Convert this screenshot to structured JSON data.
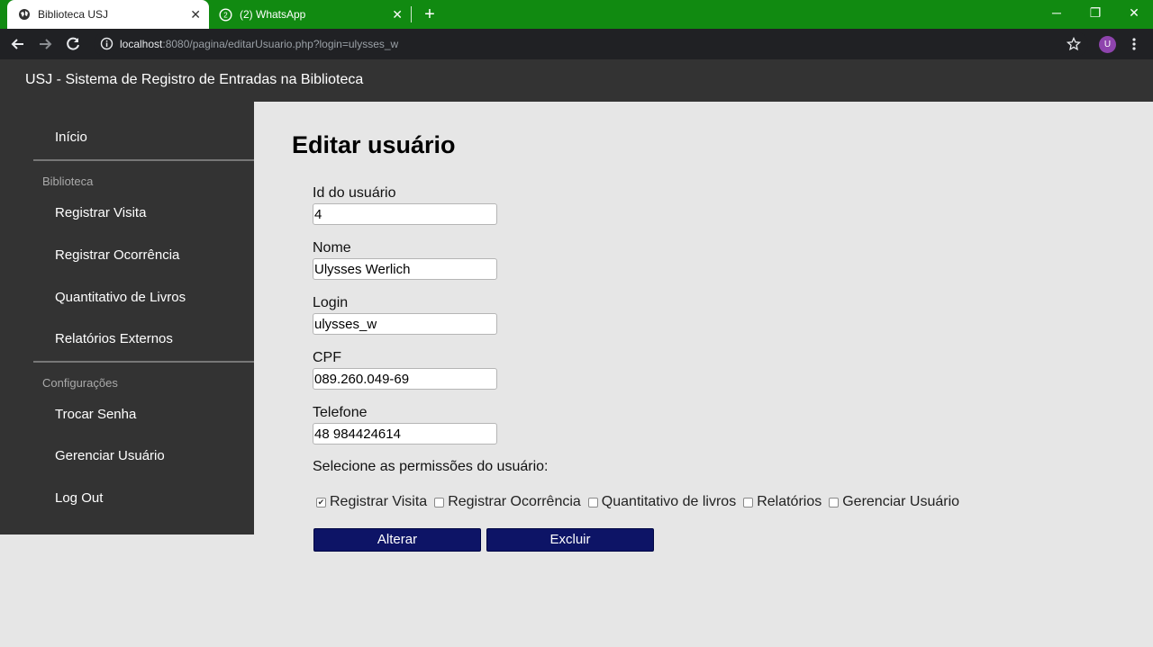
{
  "browser": {
    "tabs": [
      {
        "title": "Biblioteca USJ"
      },
      {
        "title": "(2) WhatsApp"
      }
    ],
    "url_host": "localhost",
    "url_rest": ":8080/pagina/editarUsuario.php?login=ulysses_w",
    "profile_initial": "U"
  },
  "app": {
    "title": "USJ - Sistema de Registro de Entradas na Biblioteca"
  },
  "sidebar": {
    "home": "Início",
    "section_library": "Biblioteca",
    "library_items": [
      "Registrar Visita",
      "Registrar Ocorrência",
      "Quantitativo de Livros",
      "Relatórios Externos"
    ],
    "section_settings": "Configurações",
    "settings_items": [
      "Trocar Senha",
      "Gerenciar Usuário",
      "Log Out"
    ]
  },
  "form": {
    "title": "Editar usuário",
    "fields": [
      {
        "label": "Id do usuário",
        "value": "4"
      },
      {
        "label": "Nome",
        "value": "Ulysses Werlich"
      },
      {
        "label": "Login",
        "value": "ulysses_w"
      },
      {
        "label": "CPF",
        "value": "089.260.049-69"
      },
      {
        "label": "Telefone",
        "value": "48 984424614"
      }
    ],
    "permissions_prompt": "Selecione as permissões do usuário:",
    "permissions": [
      {
        "label": "Registrar Visita",
        "checked": "true"
      },
      {
        "label": "Registrar Ocorrência",
        "checked": "false"
      },
      {
        "label": "Quantitativo de livros",
        "checked": "false"
      },
      {
        "label": "Relatórios",
        "checked": "false"
      },
      {
        "label": "Gerenciar Usuário",
        "checked": "false"
      }
    ],
    "buttons": {
      "update": "Alterar",
      "delete": "Excluir"
    }
  },
  "colors": {
    "tabbar": "#118a11",
    "header": "#333333",
    "button": "#0d1466",
    "background": "#e6e6e6"
  }
}
